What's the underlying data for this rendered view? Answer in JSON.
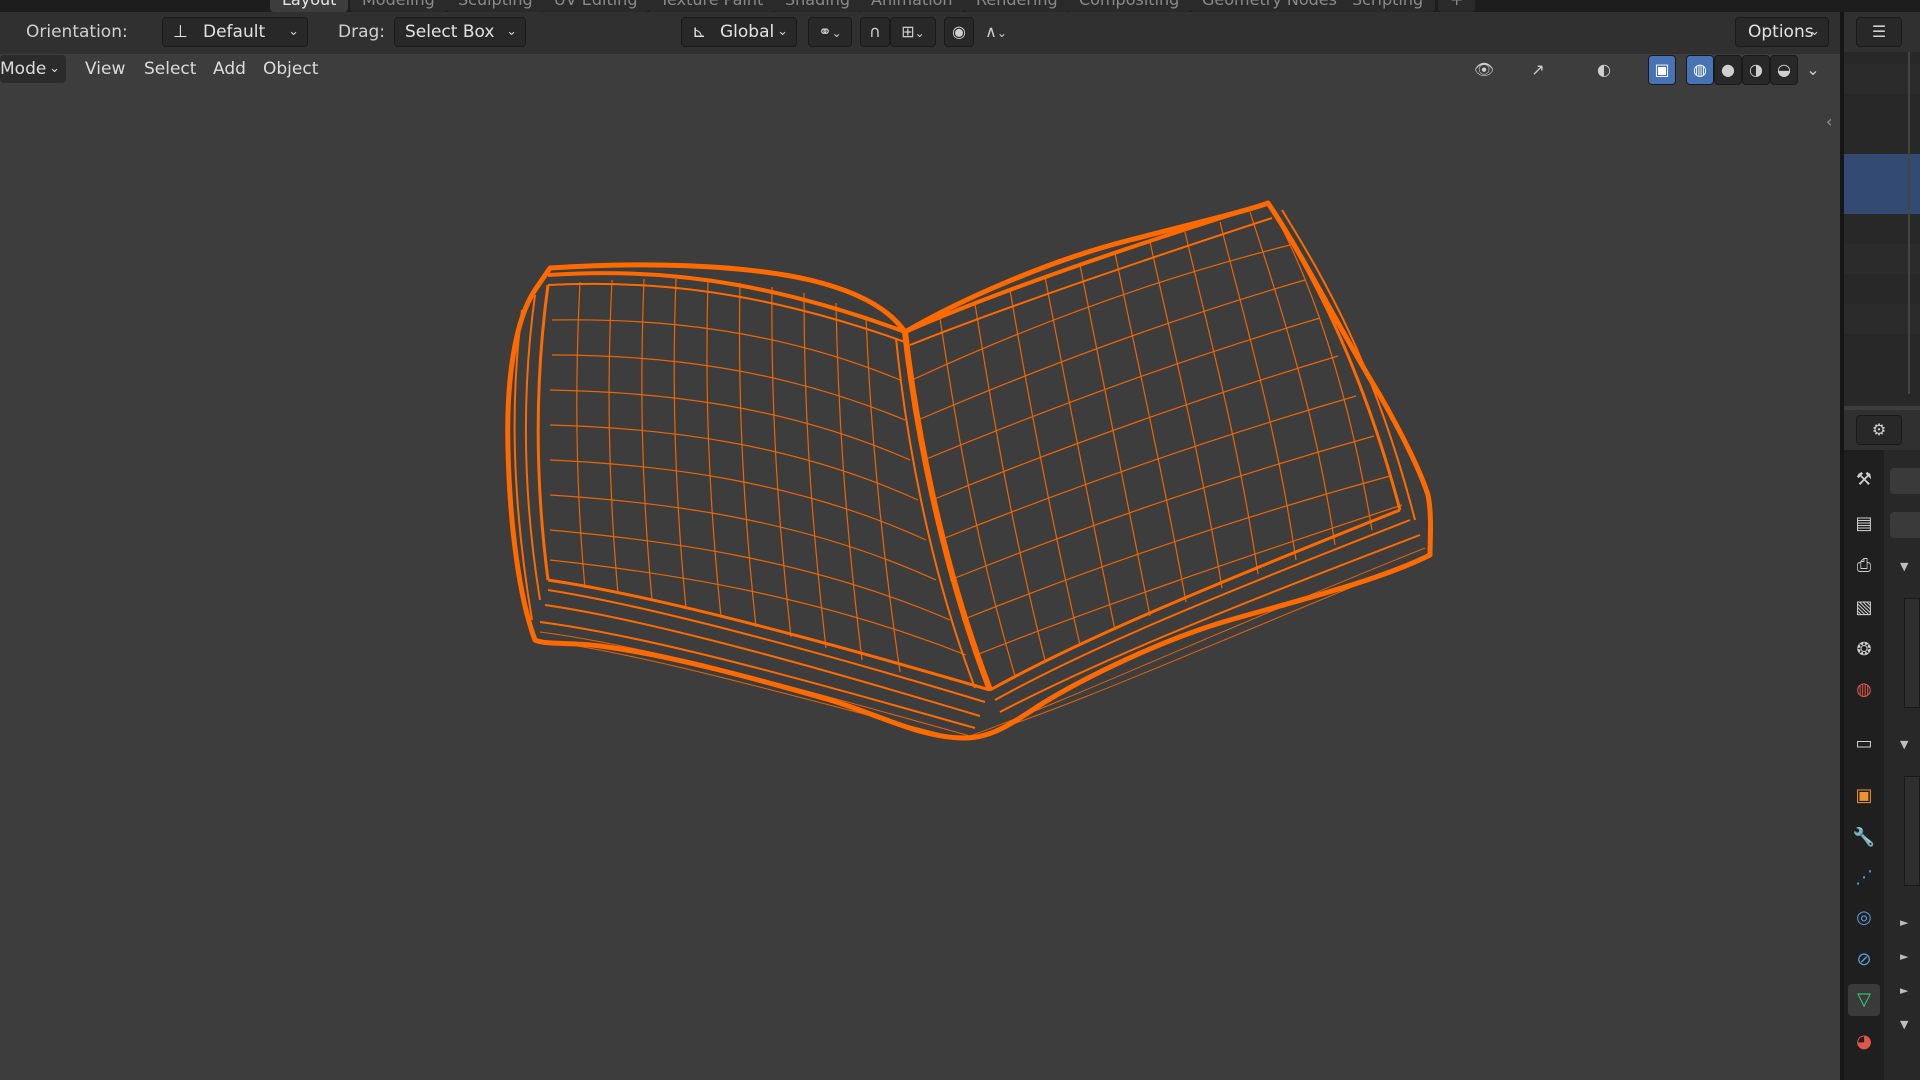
{
  "workspace_tabs": [
    {
      "label": "Layout",
      "active": true
    },
    {
      "label": "Modeling"
    },
    {
      "label": "Sculpting"
    },
    {
      "label": "UV Editing"
    },
    {
      "label": "Texture Paint"
    },
    {
      "label": "Shading"
    },
    {
      "label": "Animation"
    },
    {
      "label": "Rendering"
    },
    {
      "label": "Compositing"
    },
    {
      "label": "Geometry Nodes"
    },
    {
      "label": "Scripting"
    },
    {
      "label": "+"
    }
  ],
  "toolbar": {
    "orientation_label": "Orientation:",
    "orientation_value": "Default",
    "drag_label": "Drag:",
    "drag_value": "Select Box",
    "transform_orientation": "Global",
    "options_label": "Options"
  },
  "viewport_header": {
    "mode_label": "Mode",
    "menus": [
      "View",
      "Select",
      "Add",
      "Object"
    ],
    "shading_mode": "wireframe"
  },
  "properties_tabs": [
    {
      "icon": "tool-icon"
    },
    {
      "icon": "render-icon"
    },
    {
      "icon": "output-icon"
    },
    {
      "icon": "view-layer-icon"
    },
    {
      "icon": "scene-icon"
    },
    {
      "icon": "world-icon"
    },
    {
      "icon": "collection-icon"
    },
    {
      "icon": "object-icon"
    },
    {
      "icon": "modifier-icon"
    },
    {
      "icon": "particles-icon"
    },
    {
      "icon": "physics-icon"
    },
    {
      "icon": "constraints-icon"
    },
    {
      "icon": "object-data-icon",
      "active": true
    },
    {
      "icon": "material-icon"
    }
  ],
  "colors": {
    "selection_wire": "#ff6a00",
    "viewport_bg": "#3d3d3d",
    "accent": "#4772b3"
  }
}
